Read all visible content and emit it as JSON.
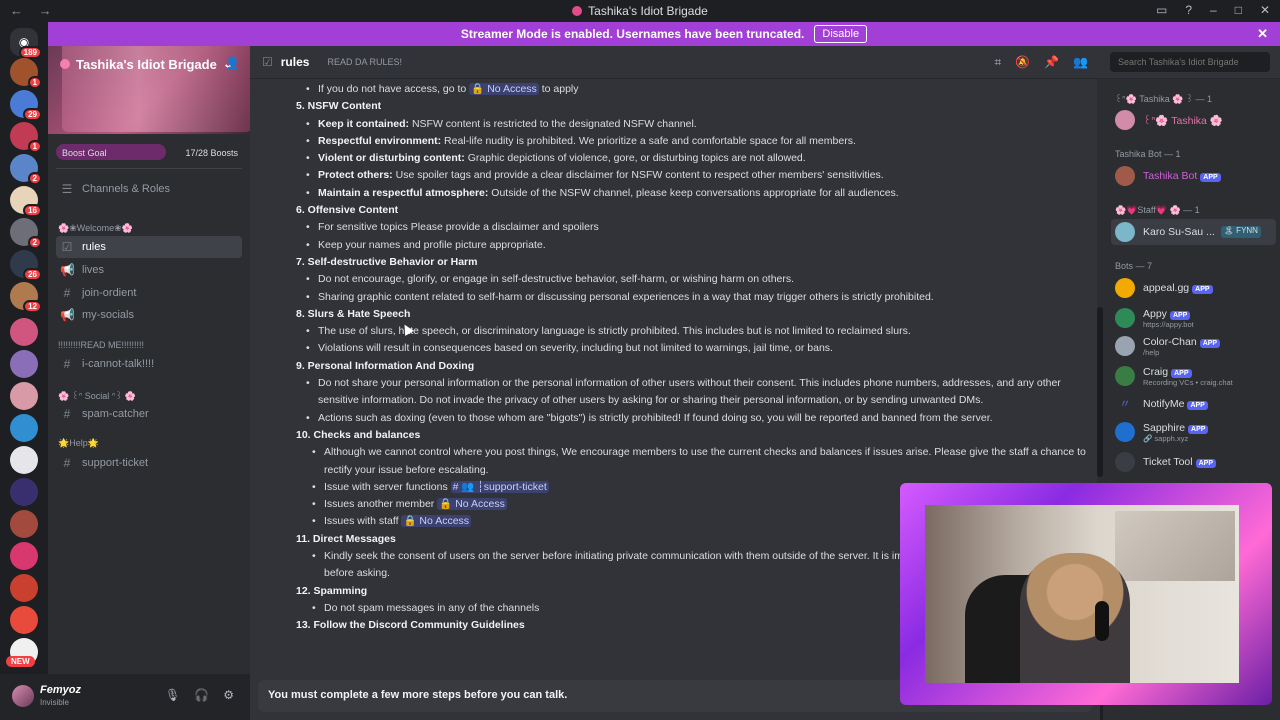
{
  "window": {
    "title": "Tashika's Idiot Brigade"
  },
  "banner": {
    "text": "Streamer Mode is enabled. Usernames have been truncated.",
    "button": "Disable"
  },
  "guilds": {
    "badges": [
      "189",
      "1",
      "29",
      "1",
      "2",
      "16",
      "2",
      "26",
      "12"
    ],
    "new_label": "NEW"
  },
  "server": {
    "name": "Tashika's Idiot Brigade",
    "boost_goal": "Boost Goal",
    "boost_count": "17/28 Boosts",
    "channels_roles": "Channels & Roles",
    "categories": {
      "welcome": "🌸❀Welcome❀🌸",
      "readme": "!!!!!!!!!READ ME!!!!!!!!!",
      "social": "🌸 ꒰ᐢ Social ᐢ꒱ 🌸",
      "help": "🌟Help🌟"
    },
    "channels": {
      "rules": "rules",
      "lives": "lives",
      "join": "join-ordient",
      "socials": "my-socials",
      "cant_talk": "i-cannot-talk!!!!",
      "spam": "spam-catcher",
      "support": "support-ticket"
    }
  },
  "user": {
    "name": "Femyoz",
    "status": "Invisible"
  },
  "header": {
    "channel": "rules",
    "topic": "READ DA RULES!",
    "search_placeholder": "Search Tashika's Idiot Brigade"
  },
  "rules": {
    "line0": "If you do not have access, go to",
    "line0_mention": "No Access",
    "line0_after": "to apply",
    "s5": "5. NSFW Content",
    "s5_b1_b": "Keep it contained:",
    "s5_b1": "NSFW content is restricted to the designated NSFW channel.",
    "s5_b2_b": "Respectful environment:",
    "s5_b2": "Real-life nudity is prohibited. We prioritize a safe and comfortable space for all members.",
    "s5_b3_b": "Violent or disturbing content:",
    "s5_b3": "Graphic depictions of violence, gore, or disturbing topics are not allowed.",
    "s5_b4_b": "Protect others:",
    "s5_b4": "Use spoiler tags and provide a clear disclaimer for NSFW content to respect other members' sensitivities.",
    "s5_b5_b": "Maintain a respectful atmosphere:",
    "s5_b5": "Outside of the NSFW channel, please keep conversations appropriate for all audiences.",
    "s6": "6. Offensive Content",
    "s6_b1": "For sensitive topics Please provide a disclaimer and spoilers",
    "s6_b2": "Keep your names and profile picture appropriate.",
    "s7": "7. Self-destructive Behavior or Harm",
    "s7_b1": "Do not encourage, glorify, or engage in self-destructive behavior, self-harm, or wishing harm on others.",
    "s7_b2": "Sharing graphic content related to self-harm or discussing personal experiences in a way that may trigger others is strictly prohibited.",
    "s8": "8. Slurs & Hate Speech",
    "s8_b1": "The use of slurs, hate speech, or discriminatory language is strictly prohibited. This includes but is not limited to reclaimed slurs.",
    "s8_b2": "Violations will result in consequences based on severity, including but not limited to warnings, jail time, or bans.",
    "s9": "9. Personal Information And Doxing",
    "s9_b1": "Do not share your personal information or the personal information of other users without their consent. This includes phone numbers, addresses, and any other sensitive information. Do not invade the privacy of other users by asking for or sharing their personal information, or by sending unwanted DMs.",
    "s9_b2": "Actions such as doxing (even to those whom are \"bigots\") is strictly prohibited! If found doing so, you will be reported and banned from the server.",
    "s10": "10. Checks and balances",
    "s10_b1": "Although we cannot control where you post things, We encourage members to use the current checks and balances if issues arise. Please give the staff a chance to rectify your issue before escalating.",
    "s10_b2": "Issue with server functions",
    "s10_b2_mention": "# 👥 ┆support-ticket",
    "s10_b3": "Issues another member",
    "s10_b3_mention": "🔒 No Access",
    "s10_b4": "Issues with staff",
    "s10_b4_mention": "🔒 No Access",
    "s11": "11. Direct Messages",
    "s11_b1": "Kindly seek the consent of users on the server before initiating private communication with them outside of the server. It is important to respect others' boundaries before asking.",
    "s12": "12. Spamming",
    "s12_b1": "Do not spam messages in any of the channels",
    "s13": "13. Follow the Discord Community Guidelines"
  },
  "composer": {
    "text": "You must complete a few more steps before you can talk."
  },
  "members": {
    "cat1": "꒰ᐢ🌸 Tashika 🌸 ꒱ — 1",
    "m1": "꒰ᐢ🌸 Tashika 🌸",
    "cat2": "Tashika Bot — 1",
    "m2": "Tashika Bot",
    "cat3": "🌸💗Staff💗 🌸 — 1",
    "m3": "Karo Su-Sau ...",
    "m3_tag": "🏝 FYNN",
    "cat4": "Bots — 7",
    "bots": [
      {
        "name": "appeal.gg",
        "sub": ""
      },
      {
        "name": "Appy",
        "sub": "https://appy.bot"
      },
      {
        "name": "Color-Chan",
        "sub": "/help"
      },
      {
        "name": "Craig",
        "sub": "Recording VCs • craig.chat"
      },
      {
        "name": "NotifyMe",
        "sub": ""
      },
      {
        "name": "Sapphire",
        "sub": "🔗 sapph.xyz"
      },
      {
        "name": "Ticket Tool",
        "sub": ""
      }
    ],
    "app_label": "APP"
  }
}
